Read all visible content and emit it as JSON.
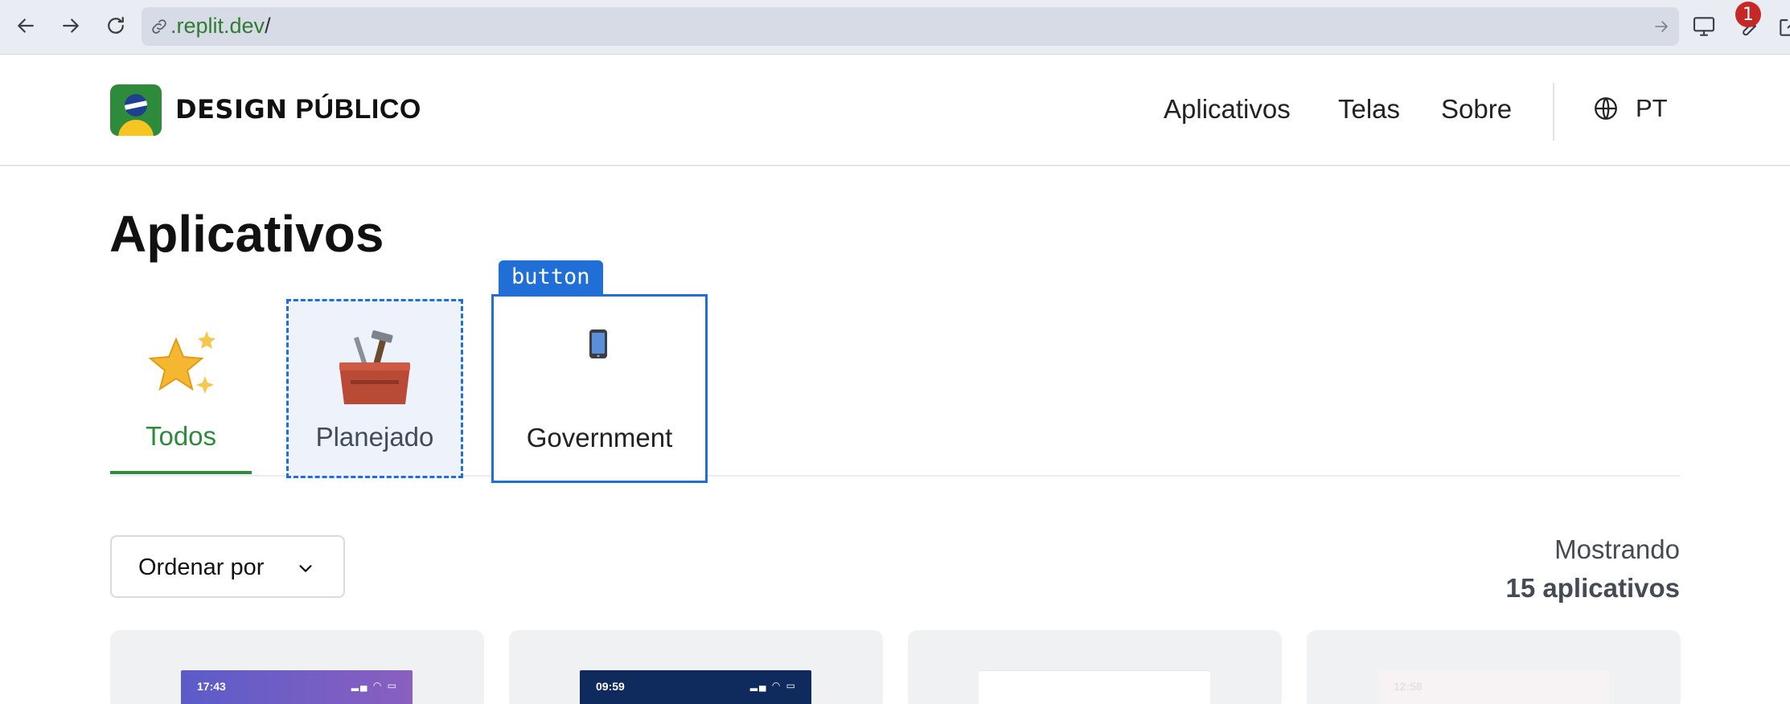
{
  "browser": {
    "url_host": ".replit.dev",
    "url_path": "/",
    "badge_count": "1"
  },
  "header": {
    "brand_bold": "DESIGN",
    "brand_light": "PÚBLICO",
    "nav": [
      "Aplicativos",
      "Telas",
      "Sobre"
    ],
    "language": "PT"
  },
  "main": {
    "title": "Aplicativos",
    "tabs": [
      {
        "label": "Todos",
        "icon": "sparkling-star-icon",
        "active": true
      },
      {
        "label": "Planejado",
        "icon": "toolbox-icon",
        "active": false
      },
      {
        "label": "Government",
        "icon": "mobile-phone-icon",
        "active": false
      }
    ],
    "overlay_tag": "button",
    "sort_label": "Ordenar por",
    "count_prefix": "Mostrando",
    "count_text": "15 aplicativos",
    "cards": [
      {
        "time": "17:43",
        "bg": "gradient-purple"
      },
      {
        "time": "09:59",
        "bg": "#0f2a5c"
      },
      {
        "time": "",
        "bg": "#ffffff"
      },
      {
        "time": "12:58",
        "bg": "#f7f2f4"
      }
    ]
  },
  "colors": {
    "accent_green": "#2e8b3b",
    "highlight_blue": "#1f6fd6"
  }
}
